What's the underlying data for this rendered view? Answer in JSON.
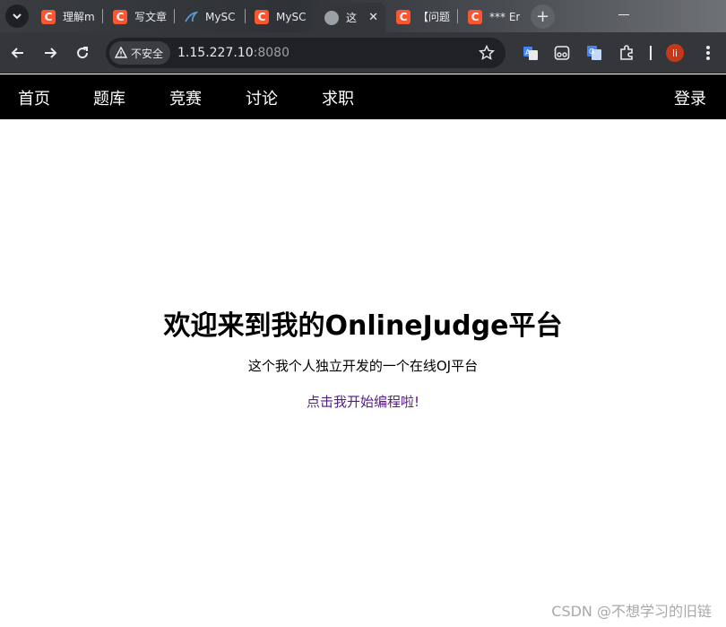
{
  "browser": {
    "tabs": [
      {
        "label": "理解m",
        "favicon": "csdn"
      },
      {
        "label": "写文章",
        "favicon": "csdn"
      },
      {
        "label": "MySC",
        "favicon": "mysql"
      },
      {
        "label": "MySC",
        "favicon": "csdn"
      },
      {
        "label": "这",
        "favicon": "globe",
        "active": true
      },
      {
        "label": "【问题",
        "favicon": "csdn"
      },
      {
        "label": "*** Er",
        "favicon": "csdn"
      }
    ],
    "security_label": "不安全",
    "url_host": "1.15.227.10",
    "url_port": ":8080",
    "profile_initial": "li"
  },
  "site_nav": {
    "items": [
      "首页",
      "题库",
      "竞赛",
      "讨论",
      "求职"
    ],
    "login": "登录"
  },
  "hero": {
    "title": "欢迎来到我的OnlineJudge平台",
    "subtitle": "这个我个人独立开发的一个在线OJ平台",
    "link": "点击我开始编程啦!"
  },
  "watermark": "CSDN @不想学习的旧链",
  "colors": {
    "nav_bg": "#000000",
    "link_visited": "#551a8b",
    "csdn_brand": "#fc5531"
  }
}
